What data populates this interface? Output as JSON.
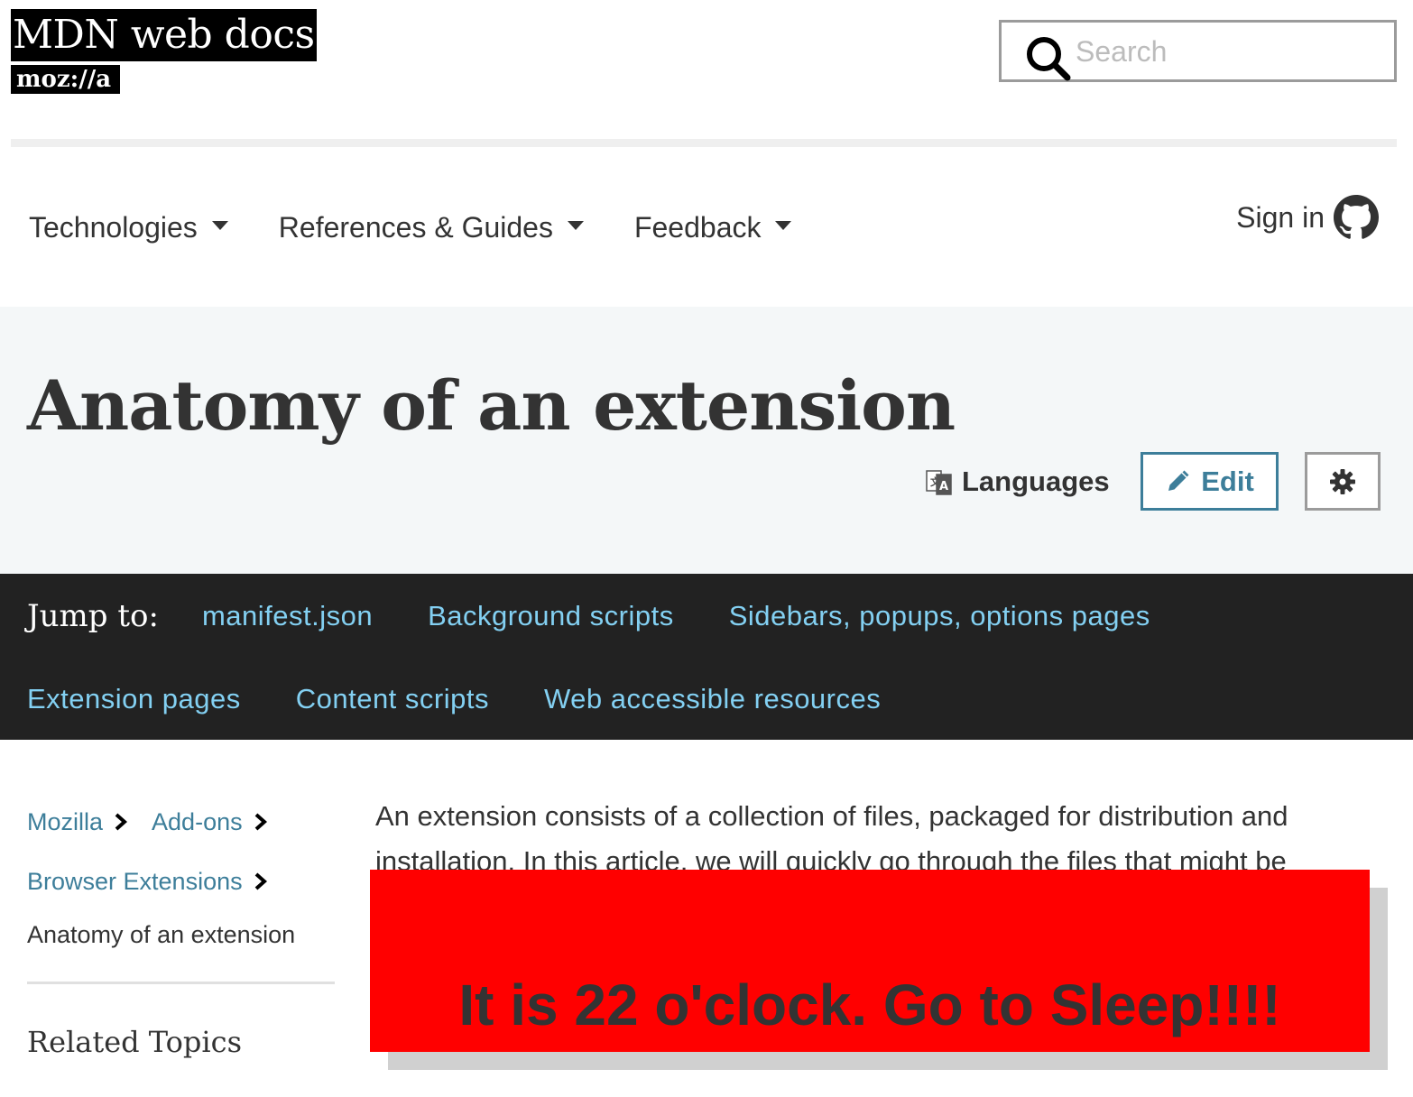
{
  "header": {
    "logo_text": "MDN web docs",
    "logo_sub": "moz://a",
    "search": {
      "placeholder": "Search",
      "value": ""
    }
  },
  "nav": {
    "items": [
      {
        "label": "Technologies"
      },
      {
        "label": "References & Guides"
      },
      {
        "label": "Feedback"
      }
    ],
    "signin_label": "Sign in"
  },
  "title_band": {
    "title": "Anatomy of an extension",
    "languages_label": "Languages",
    "edit_label": "Edit"
  },
  "jump": {
    "label": "Jump to:",
    "links": [
      "manifest.json",
      "Background scripts",
      "Sidebars, popups, options pages",
      "Extension pages",
      "Content scripts",
      "Web accessible resources"
    ]
  },
  "breadcrumbs": {
    "items": [
      "Mozilla",
      "Add-ons",
      "Browser Extensions"
    ],
    "current": "Anatomy of an extension"
  },
  "sidebar": {
    "related_heading": "Related Topics"
  },
  "article": {
    "intro": "An extension consists of a collection of files, packaged for distribution and installation. In this article, we will quickly go through the files that might be"
  },
  "overlay": {
    "message": "It is 22 o'clock. Go to Sleep!!!!",
    "color": "#ff0000"
  },
  "colors": {
    "link": "#3d7e9a",
    "jump_link": "#83d0f2",
    "jump_bg": "#222222",
    "title_band_bg": "#f4f7f8"
  }
}
